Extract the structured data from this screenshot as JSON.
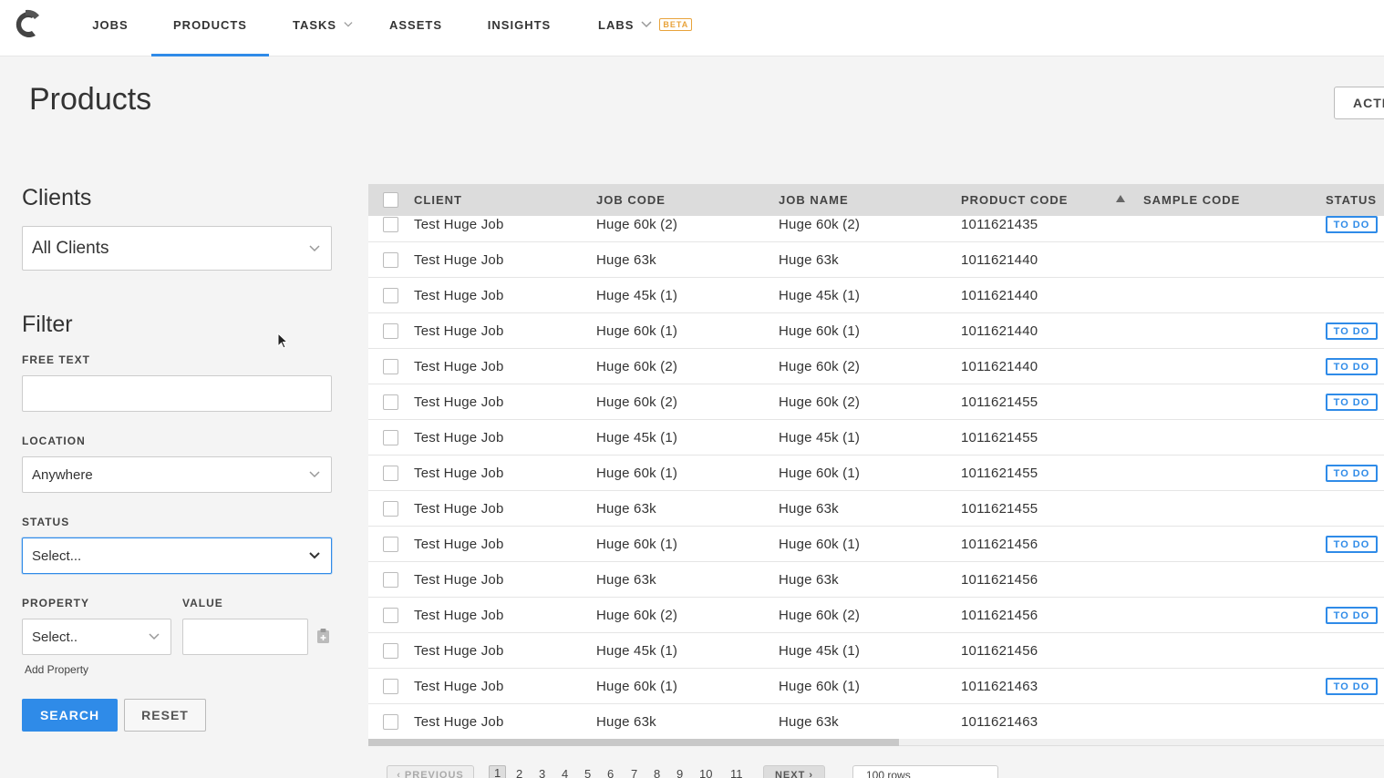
{
  "nav": {
    "items": [
      {
        "label": "JOBS",
        "name": "nav-item-jobs",
        "left": 0
      },
      {
        "label": "PRODUCTS",
        "name": "nav-item-products"
      },
      {
        "label": "TASKS",
        "name": "nav-item-tasks"
      },
      {
        "label": "ASSETS",
        "name": "nav-item-assets"
      },
      {
        "label": "INSIGHTS",
        "name": "nav-item-insights"
      },
      {
        "label": "LABS",
        "name": "nav-item-labs"
      }
    ],
    "beta_label": "BETA",
    "active": "PRODUCTS"
  },
  "header": {
    "title": "Products",
    "actions_label": "ACTI"
  },
  "sidebar": {
    "clients_title": "Clients",
    "clients_select": "All Clients",
    "filter_title": "Filter",
    "free_text_label": "FREE TEXT",
    "free_text_value": "",
    "location_label": "LOCATION",
    "location_value": "Anywhere",
    "status_label": "STATUS",
    "status_value": "Select...",
    "property_label": "PROPERTY",
    "property_value": "Select..",
    "value_label": "VALUE",
    "value_value": "",
    "add_property": "Add Property",
    "search_label": "SEARCH",
    "reset_label": "RESET"
  },
  "table": {
    "columns": [
      "CLIENT",
      "JOB CODE",
      "JOB NAME",
      "PRODUCT CODE",
      "SAMPLE CODE",
      "STATUS"
    ],
    "status_badge": "TO DO",
    "rows": [
      {
        "client": "Test Huge Job",
        "job_code": "Huge 60k (2)",
        "job_name": "Huge 60k (2)",
        "product_code": "1011621435",
        "sample_code": "",
        "status": "TO DO"
      },
      {
        "client": "Test Huge Job",
        "job_code": "Huge 63k",
        "job_name": "Huge 63k",
        "product_code": "1011621440",
        "sample_code": "",
        "status": ""
      },
      {
        "client": "Test Huge Job",
        "job_code": "Huge 45k (1)",
        "job_name": "Huge 45k (1)",
        "product_code": "1011621440",
        "sample_code": "",
        "status": ""
      },
      {
        "client": "Test Huge Job",
        "job_code": "Huge 60k (1)",
        "job_name": "Huge 60k (1)",
        "product_code": "1011621440",
        "sample_code": "",
        "status": "TO DO"
      },
      {
        "client": "Test Huge Job",
        "job_code": "Huge 60k (2)",
        "job_name": "Huge 60k (2)",
        "product_code": "1011621440",
        "sample_code": "",
        "status": "TO DO"
      },
      {
        "client": "Test Huge Job",
        "job_code": "Huge 60k (2)",
        "job_name": "Huge 60k (2)",
        "product_code": "1011621455",
        "sample_code": "",
        "status": "TO DO"
      },
      {
        "client": "Test Huge Job",
        "job_code": "Huge 45k (1)",
        "job_name": "Huge 45k (1)",
        "product_code": "1011621455",
        "sample_code": "",
        "status": ""
      },
      {
        "client": "Test Huge Job",
        "job_code": "Huge 60k (1)",
        "job_name": "Huge 60k (1)",
        "product_code": "1011621455",
        "sample_code": "",
        "status": "TO DO"
      },
      {
        "client": "Test Huge Job",
        "job_code": "Huge 63k",
        "job_name": "Huge 63k",
        "product_code": "1011621455",
        "sample_code": "",
        "status": ""
      },
      {
        "client": "Test Huge Job",
        "job_code": "Huge 60k (1)",
        "job_name": "Huge 60k (1)",
        "product_code": "1011621456",
        "sample_code": "",
        "status": "TO DO"
      },
      {
        "client": "Test Huge Job",
        "job_code": "Huge 63k",
        "job_name": "Huge 63k",
        "product_code": "1011621456",
        "sample_code": "",
        "status": ""
      },
      {
        "client": "Test Huge Job",
        "job_code": "Huge 60k (2)",
        "job_name": "Huge 60k (2)",
        "product_code": "1011621456",
        "sample_code": "",
        "status": "TO DO"
      },
      {
        "client": "Test Huge Job",
        "job_code": "Huge 45k (1)",
        "job_name": "Huge 45k (1)",
        "product_code": "1011621456",
        "sample_code": "",
        "status": ""
      },
      {
        "client": "Test Huge Job",
        "job_code": "Huge 60k (1)",
        "job_name": "Huge 60k (1)",
        "product_code": "1011621463",
        "sample_code": "",
        "status": "TO DO"
      },
      {
        "client": "Test Huge Job",
        "job_code": "Huge 63k",
        "job_name": "Huge 63k",
        "product_code": "1011621463",
        "sample_code": "",
        "status": ""
      }
    ]
  },
  "pagination": {
    "previous_label": "‹ PREVIOUS",
    "next_label": "NEXT ›",
    "pages": [
      "1",
      "2",
      "3",
      "4",
      "5",
      "6",
      "7",
      "8",
      "9",
      "10",
      "11"
    ],
    "current_page": "1",
    "rows_per_page": "100 rows"
  },
  "colors": {
    "accent": "#2f8be8",
    "beta": "#e8a33b"
  }
}
